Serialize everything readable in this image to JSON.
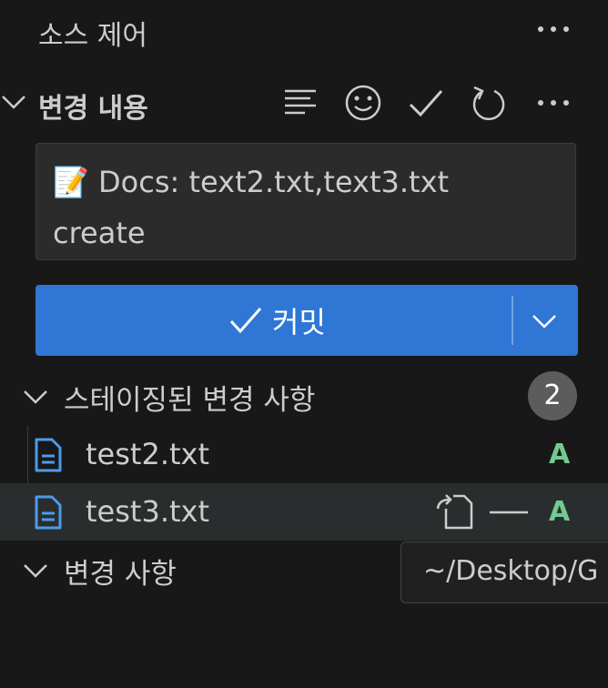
{
  "header": {
    "title": "소스 제어",
    "more_icon": "ellipsis-icon"
  },
  "changes_section": {
    "title": "변경 내용",
    "actions": [
      {
        "icon": "list-view-icon"
      },
      {
        "icon": "emoji-icon"
      },
      {
        "icon": "check-icon"
      },
      {
        "icon": "refresh-icon"
      },
      {
        "icon": "ellipsis-icon"
      }
    ]
  },
  "commit": {
    "message": "📝 Docs: text2.txt,text3.txt\ncreate",
    "button_label": "커밋",
    "button_color": "#3076d5"
  },
  "staged": {
    "title": "스테이징된 변경 사항",
    "count": "2",
    "files": [
      {
        "name": "test2.txt",
        "status": "A"
      },
      {
        "name": "test3.txt",
        "status": "A"
      }
    ]
  },
  "changes": {
    "title": "변경 사항"
  },
  "tooltip": {
    "text": "~/Desktop/G"
  },
  "colors": {
    "added": "#73c991",
    "file_icon": "#4d9be8",
    "background": "#181818"
  }
}
